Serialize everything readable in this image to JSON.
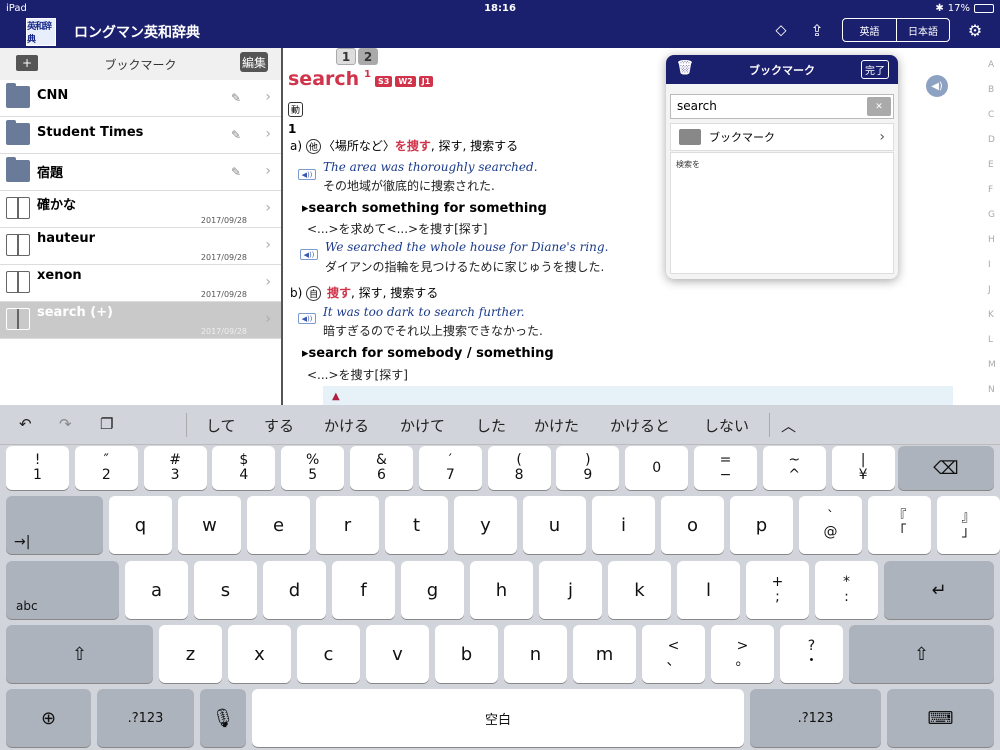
{
  "status": {
    "device": "iPad",
    "time": "18:16",
    "battery": "17%"
  },
  "nav": {
    "logo": "英和辞典",
    "title": "ロングマン英和辞典",
    "seg_left": "英語",
    "seg_right": "日本語"
  },
  "sidebar": {
    "title": "ブックマーク",
    "edit": "編集",
    "items": [
      {
        "label": "CNN",
        "kind": "folder",
        "date": ""
      },
      {
        "label": "Student Times",
        "kind": "folder",
        "date": ""
      },
      {
        "label": "宿題",
        "kind": "folder",
        "date": ""
      },
      {
        "label": "確かな",
        "kind": "book",
        "date": "2017/09/28"
      },
      {
        "label": "hauteur",
        "kind": "book",
        "date": "2017/09/28"
      },
      {
        "label": "xenon",
        "kind": "book",
        "date": "2017/09/28"
      },
      {
        "label": "search (+)",
        "kind": "book",
        "date": "2017/09/28"
      }
    ]
  },
  "entry": {
    "tabs": [
      "1",
      "2"
    ],
    "headword": "search",
    "sup": "1",
    "badges": [
      "S3",
      "W2",
      "J1"
    ],
    "pos": "動",
    "sense_num": "1",
    "a_label": "a)",
    "a_circle": "他",
    "a_pre": "〈場所など〉",
    "a_red": "を捜す",
    "a_post": ", 探す, 捜索する",
    "ex1_en": "The area was thoroughly searched.",
    "ex1_ja": "その地域が徹底的に捜索された.",
    "phr1": "search something for something",
    "phr1_ja": "<...>を求めて<...>を捜す[探す]",
    "ex2_en": "We searched the whole house for Diane's ring.",
    "ex2_ja": "ダイアンの指輪を見つけるために家じゅうを捜した.",
    "b_label": "b)",
    "b_circle": "自",
    "b_red": "捜す",
    "b_post": ", 探す, 捜索する",
    "ex3_en": "It was too dark to search further.",
    "ex3_ja": "暗すぎるのでそれ以上捜索できなかった.",
    "phr2": "search for somebody / something",
    "phr2_ja": "<...>を捜す[探す]",
    "speaker": "◀))"
  },
  "index": [
    "A",
    "B",
    "C",
    "D",
    "E",
    "F",
    "G",
    "H",
    "I",
    "J",
    "K",
    "L",
    "M",
    "N"
  ],
  "popover": {
    "title": "ブックマーク",
    "done": "完了",
    "search_value": "search",
    "row": "ブックマーク",
    "note": "検索を"
  },
  "keyboard": {
    "candidates": [
      "して",
      "する",
      "かける",
      "かけて",
      "した",
      "かけた",
      "かけると",
      "しない"
    ],
    "row1": [
      [
        "!",
        "1"
      ],
      [
        "″",
        "2"
      ],
      [
        "#",
        "3"
      ],
      [
        "$",
        "4"
      ],
      [
        "%",
        "5"
      ],
      [
        "&",
        "6"
      ],
      [
        "′",
        "7"
      ],
      [
        "(",
        "8"
      ],
      [
        ")",
        "9"
      ],
      [
        "",
        "0"
      ],
      [
        "=",
        "−"
      ],
      [
        "~",
        "^"
      ],
      [
        "|",
        "¥"
      ]
    ],
    "row2": [
      "q",
      "w",
      "e",
      "r",
      "t",
      "y",
      "u",
      "i",
      "o",
      "p"
    ],
    "row2_extra": [
      [
        "`",
        "@"
      ],
      [
        "『",
        "「"
      ],
      [
        "』",
        "」"
      ]
    ],
    "row3": [
      "a",
      "s",
      "d",
      "f",
      "g",
      "h",
      "j",
      "k",
      "l"
    ],
    "row3_extra": [
      [
        "+",
        ";"
      ],
      [
        "*",
        ":"
      ]
    ],
    "row4": [
      "z",
      "x",
      "c",
      "v",
      "b",
      "n",
      "m"
    ],
    "row4_extra": [
      [
        "<",
        "、"
      ],
      [
        ">",
        "。"
      ],
      [
        "?",
        "・"
      ]
    ],
    "abc": "abc",
    "num_left": ".?123",
    "num_right": ".?123",
    "space": "空白"
  }
}
